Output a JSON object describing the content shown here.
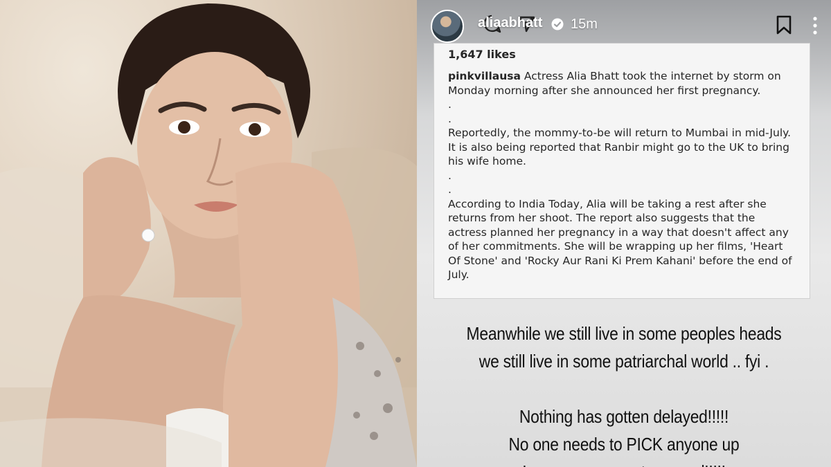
{
  "story": {
    "username": "aliaabhatt",
    "timestamp": "15m",
    "icons": {
      "avatar": "profile-avatar",
      "comment": "comment-bubble-icon",
      "send": "paper-plane-icon",
      "verified": "verified-badge-icon",
      "bookmark": "bookmark-icon",
      "more": "more-vertical-icon"
    },
    "post": {
      "likes": "1,647 likes",
      "handle": "pinkvillausa",
      "paragraph1": "Actress Alia Bhatt took the internet by storm on Monday morning after she announced her first pregnancy.",
      "dot1": ".",
      "dot2": ".",
      "paragraph2": "Reportedly, the mommy-to-be will return to Mumbai in mid-July. It is also being reported that Ranbir might go to the UK to bring his wife home.",
      "dot3": ".",
      "dot4": ".",
      "paragraph3": "According to India Today, Alia will be taking a rest after she returns from her shoot. The report also suggests that the actress planned her pregnancy in a way that doesn't affect any of her commitments. She will be wrapping up her films, 'Heart Of Stone' and 'Rocky Aur Rani Ki Prem Kahani' before the end of July."
    },
    "overlay": {
      "line1": "Meanwhile we still live in some peoples heads",
      "line2": "we still live in some patriarchal world .. fyi .",
      "line3": "Nothing has gotten delayed!!!!!",
      "line4": "No one needs to PICK anyone up",
      "line5": "I am a woman not a parcel!!!!!"
    }
  },
  "colors": {
    "text_dark": "#262626",
    "header_text": "#ffffff",
    "card_bg": "#f5f5f5"
  }
}
